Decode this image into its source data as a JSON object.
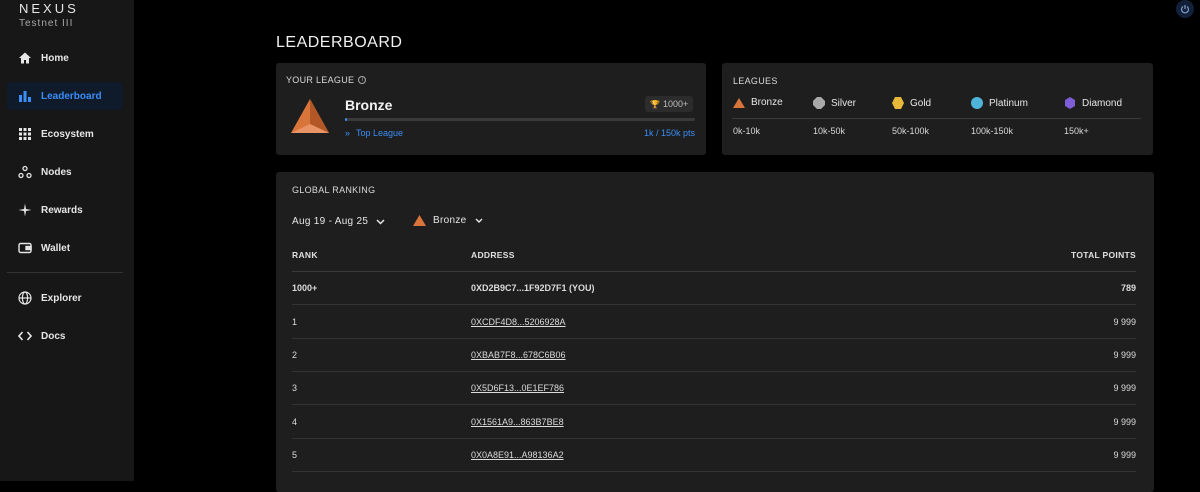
{
  "brand": {
    "name": "NEXUS",
    "subtitle": "Testnet III"
  },
  "sidebar": {
    "items": [
      {
        "label": "Home",
        "icon": "home-icon",
        "active": false
      },
      {
        "label": "Leaderboard",
        "icon": "bar-chart-icon",
        "active": true
      },
      {
        "label": "Ecosystem",
        "icon": "grid-icon",
        "active": false
      },
      {
        "label": "Nodes",
        "icon": "nodes-icon",
        "active": false
      },
      {
        "label": "Rewards",
        "icon": "sparkle-icon",
        "active": false
      },
      {
        "label": "Wallet",
        "icon": "wallet-icon",
        "active": false
      },
      {
        "label": "Explorer",
        "icon": "globe-icon",
        "active": false
      },
      {
        "label": "Docs",
        "icon": "code-icon",
        "active": false
      }
    ]
  },
  "page": {
    "title": "LEADERBOARD"
  },
  "your_league": {
    "heading": "YOUR LEAGUE",
    "info_icon": "info-icon",
    "league": "Bronze",
    "badge": "1000+",
    "progress": 0.0067,
    "top_league_link": "Top League",
    "points": "1k / 150k pts"
  },
  "leagues": {
    "heading": "LEAGUES",
    "items": [
      {
        "name": "Bronze",
        "range": "0k-10k",
        "color": "#d9743b"
      },
      {
        "name": "Silver",
        "range": "10k-50k",
        "color": "#a9a9a9"
      },
      {
        "name": "Gold",
        "range": "50k-100k",
        "color": "#e8b83a"
      },
      {
        "name": "Platinum",
        "range": "100k-150k",
        "color": "#4fb4d8"
      },
      {
        "name": "Diamond",
        "range": "150k+",
        "color": "#7e5ed6"
      }
    ]
  },
  "ranking": {
    "heading": "GLOBAL RANKING",
    "date_filter": "Aug 19 - Aug 25",
    "league_filter": "Bronze",
    "columns": {
      "rank": "RANK",
      "address": "ADDRESS",
      "points": "TOTAL POINTS"
    },
    "rows": [
      {
        "rank": "1000+",
        "address": "0XD2B9C7...1F92D7F1 (YOU)",
        "points": "789",
        "you": true
      },
      {
        "rank": "1",
        "address": "0XCDF4D8...5206928A",
        "points": "9 999",
        "you": false
      },
      {
        "rank": "2",
        "address": "0XBAB7F8...678C6B06",
        "points": "9 999",
        "you": false
      },
      {
        "rank": "3",
        "address": "0X5D6F13...0E1EF786",
        "points": "9 999",
        "you": false
      },
      {
        "rank": "4",
        "address": "0X1561A9...863B7BE8",
        "points": "9 999",
        "you": false
      },
      {
        "rank": "5",
        "address": "0X0A8E91...A98136A2",
        "points": "9 999",
        "you": false
      }
    ]
  },
  "colors": {
    "accent": "#3a8ef6",
    "bronze": "#d9743b",
    "card": "#1e1e1e",
    "sidebar": "#171717"
  }
}
